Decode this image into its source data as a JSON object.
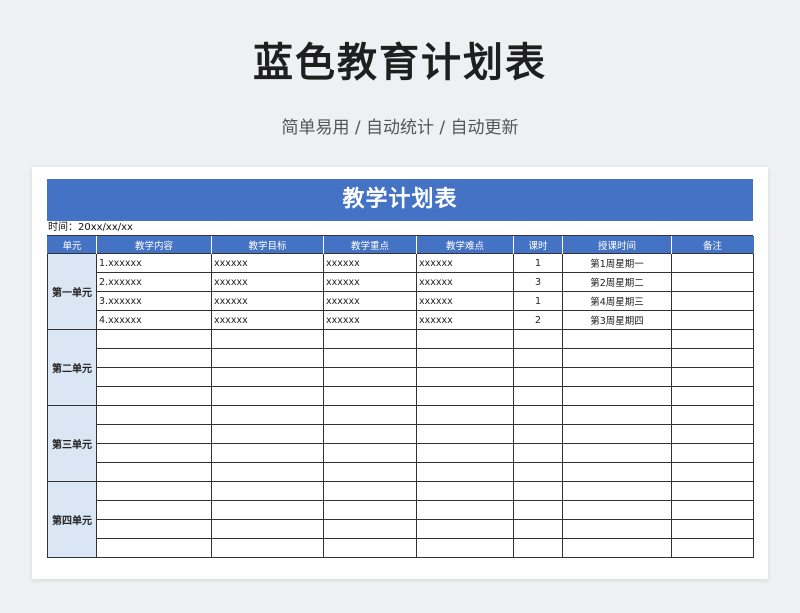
{
  "header": {
    "title": "蓝色教育计划表",
    "subtitle": "简单易用 / 自动统计 / 自动更新"
  },
  "sheet": {
    "title": "教学计划表",
    "date_line": "时间：20xx/xx/xx",
    "columns": [
      "单元",
      "教学内容",
      "教学目标",
      "教学重点",
      "教学难点",
      "课时",
      "授课时间",
      "备注"
    ],
    "units": [
      {
        "name": "第一单元",
        "rows": [
          {
            "content": "1.xxxxxx",
            "goal": "xxxxxx",
            "key": "xxxxxx",
            "difficulty": "xxxxxx",
            "hours": "1",
            "time": "第1周星期一",
            "note": ""
          },
          {
            "content": "2.xxxxxx",
            "goal": "xxxxxx",
            "key": "xxxxxx",
            "difficulty": "xxxxxx",
            "hours": "3",
            "time": "第2周星期二",
            "note": ""
          },
          {
            "content": "3.xxxxxx",
            "goal": "xxxxxx",
            "key": "xxxxxx",
            "difficulty": "xxxxxx",
            "hours": "1",
            "time": "第4周星期三",
            "note": ""
          },
          {
            "content": "4.xxxxxx",
            "goal": "xxxxxx",
            "key": "xxxxxx",
            "difficulty": "xxxxxx",
            "hours": "2",
            "time": "第3周星期四",
            "note": ""
          }
        ]
      },
      {
        "name": "第二单元",
        "rows": [
          {
            "content": "",
            "goal": "",
            "key": "",
            "difficulty": "",
            "hours": "",
            "time": "",
            "note": ""
          },
          {
            "content": "",
            "goal": "",
            "key": "",
            "difficulty": "",
            "hours": "",
            "time": "",
            "note": ""
          },
          {
            "content": "",
            "goal": "",
            "key": "",
            "difficulty": "",
            "hours": "",
            "time": "",
            "note": ""
          },
          {
            "content": "",
            "goal": "",
            "key": "",
            "difficulty": "",
            "hours": "",
            "time": "",
            "note": ""
          }
        ]
      },
      {
        "name": "第三单元",
        "rows": [
          {
            "content": "",
            "goal": "",
            "key": "",
            "difficulty": "",
            "hours": "",
            "time": "",
            "note": ""
          },
          {
            "content": "",
            "goal": "",
            "key": "",
            "difficulty": "",
            "hours": "",
            "time": "",
            "note": ""
          },
          {
            "content": "",
            "goal": "",
            "key": "",
            "difficulty": "",
            "hours": "",
            "time": "",
            "note": ""
          },
          {
            "content": "",
            "goal": "",
            "key": "",
            "difficulty": "",
            "hours": "",
            "time": "",
            "note": ""
          }
        ]
      },
      {
        "name": "第四单元",
        "rows": [
          {
            "content": "",
            "goal": "",
            "key": "",
            "difficulty": "",
            "hours": "",
            "time": "",
            "note": ""
          },
          {
            "content": "",
            "goal": "",
            "key": "",
            "difficulty": "",
            "hours": "",
            "time": "",
            "note": ""
          },
          {
            "content": "",
            "goal": "",
            "key": "",
            "difficulty": "",
            "hours": "",
            "time": "",
            "note": ""
          },
          {
            "content": "",
            "goal": "",
            "key": "",
            "difficulty": "",
            "hours": "",
            "time": "",
            "note": ""
          }
        ]
      }
    ]
  },
  "colors": {
    "accent": "#4472c4",
    "unit_fill": "#dbe6f4",
    "page_bg": "#eef0f4"
  }
}
